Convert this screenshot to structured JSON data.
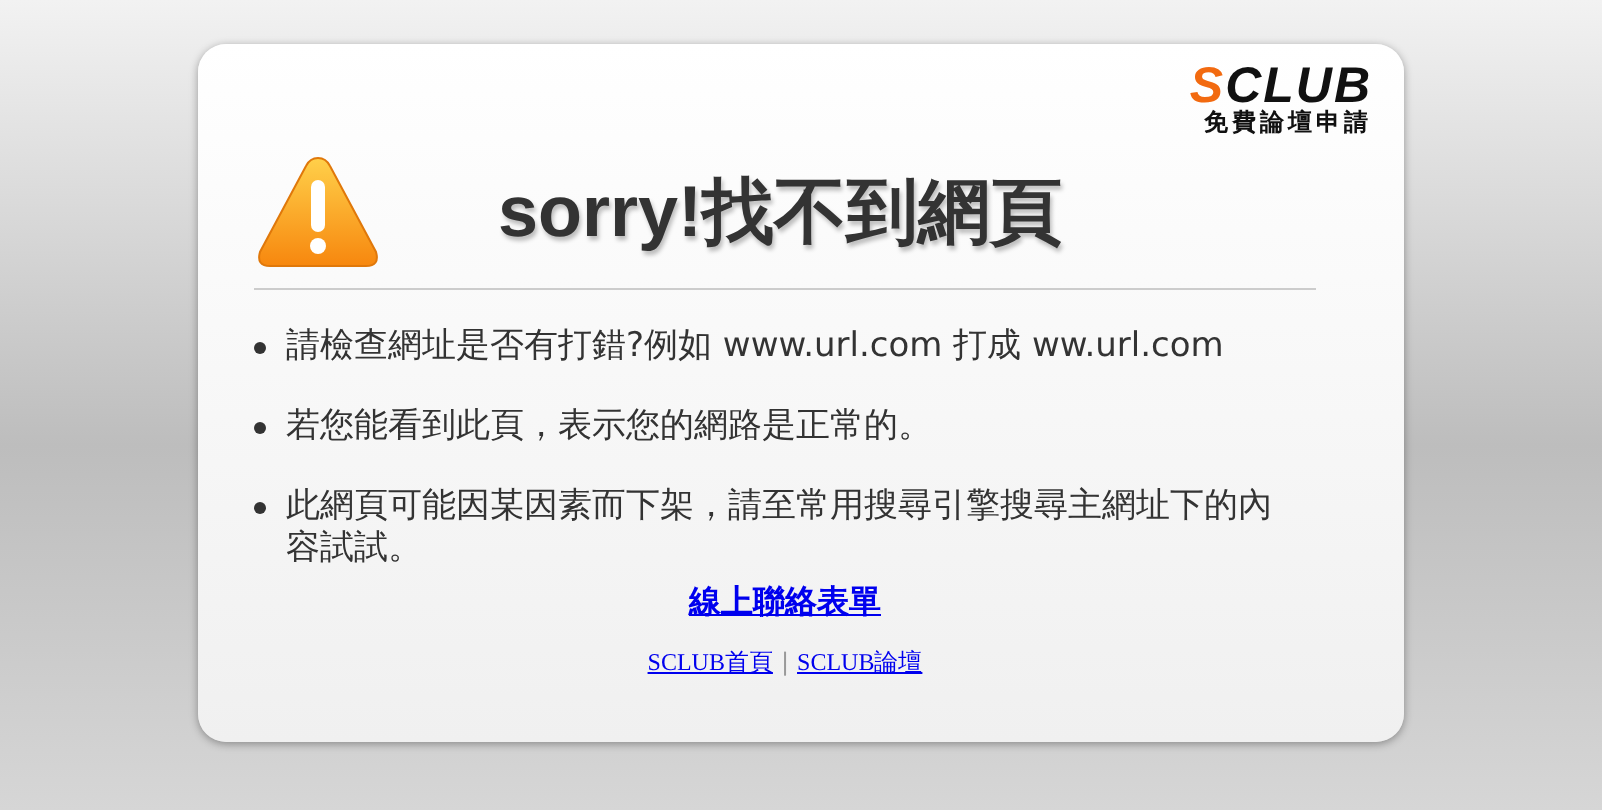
{
  "logo": {
    "accent": "S",
    "rest": "CLUB",
    "tagline": "免費論壇申請"
  },
  "title": "sorry!找不到網頁",
  "tips": [
    {
      "text": "請檢查網址是否有打錯?例如 www.url.com 打成 ww.url.com"
    },
    {
      "text": "若您能看到此頁，表示您的網路是正常的。"
    },
    {
      "text": "此網頁可能因某因素而下架，請至常用搜尋引擎搜尋主網址下的內容試試。"
    }
  ],
  "contact_link": "線上聯絡表單",
  "footer_links": [
    "SCLUB首頁",
    "SCLUB論壇"
  ],
  "footer_separator": "|"
}
